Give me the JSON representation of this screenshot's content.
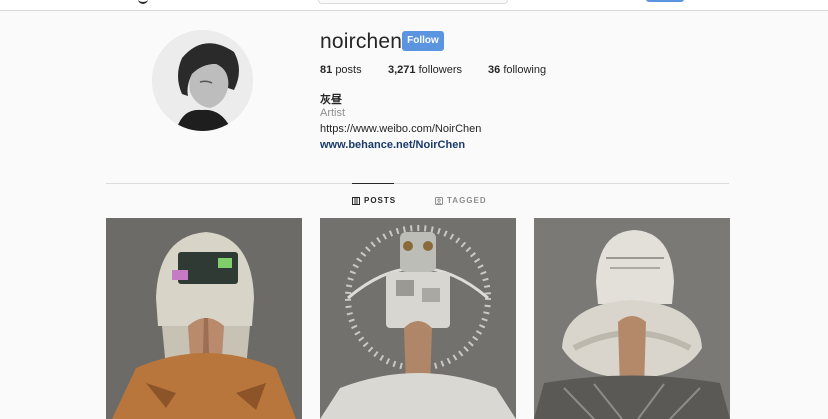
{
  "profile": {
    "username": "noirchen",
    "follow_label": "Follow",
    "posts_count": "81",
    "posts_label": "posts",
    "followers_count": "3,271",
    "followers_label": "followers",
    "following_count": "36",
    "following_label": "following",
    "full_name": "灰昼",
    "category": "Artist",
    "bio_link": "https://www.weibo.com/NoirChen",
    "website": "www.behance.net/NoirChen"
  },
  "tabs": [
    {
      "label": "POSTS",
      "icon": "grid-icon",
      "active": true
    },
    {
      "label": "TAGGED",
      "icon": "tag-icon",
      "active": false
    }
  ],
  "posts": [
    {
      "subject": "figure with white helmet and green visor, hands pressed together"
    },
    {
      "subject": "figure with ornate metallic headdress, hands pressed together"
    },
    {
      "subject": "figure with white dome helmet and collar, hands pressed together"
    }
  ],
  "colors": {
    "accent": "#5b95e0",
    "link": "#1b3a6b",
    "muted": "#8e8e8e",
    "background": "#fafafa"
  }
}
